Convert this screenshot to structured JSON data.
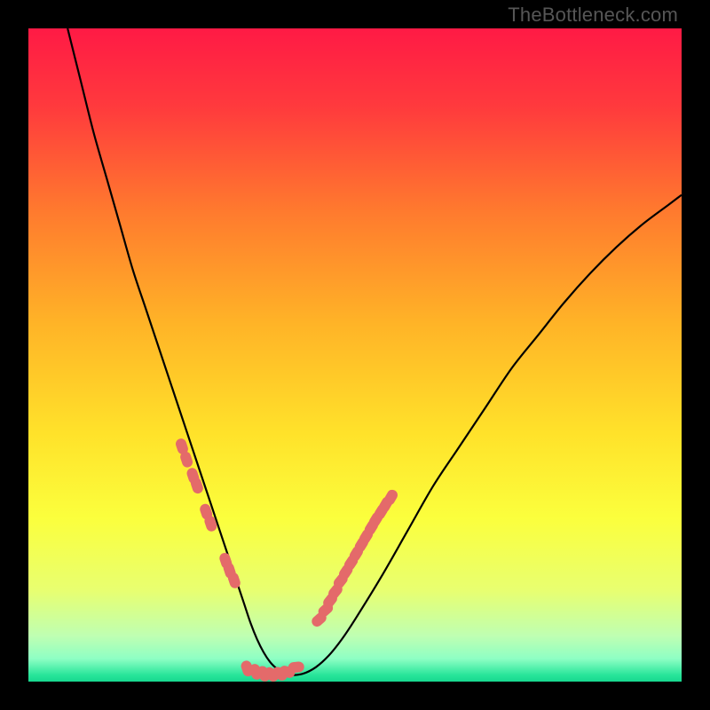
{
  "watermark": "TheBottleneck.com",
  "chart_data": {
    "type": "line",
    "title": "",
    "xlabel": "",
    "ylabel": "",
    "xlim": [
      0,
      100
    ],
    "ylim": [
      0,
      100
    ],
    "gradient_stops": [
      {
        "offset": 0.0,
        "color": "#ff1a45"
      },
      {
        "offset": 0.12,
        "color": "#ff3a3d"
      },
      {
        "offset": 0.28,
        "color": "#ff7a2e"
      },
      {
        "offset": 0.45,
        "color": "#ffb327"
      },
      {
        "offset": 0.62,
        "color": "#ffe22a"
      },
      {
        "offset": 0.75,
        "color": "#fbff3d"
      },
      {
        "offset": 0.86,
        "color": "#e8ff70"
      },
      {
        "offset": 0.93,
        "color": "#bfffb2"
      },
      {
        "offset": 0.965,
        "color": "#8effc4"
      },
      {
        "offset": 0.99,
        "color": "#28e59a"
      },
      {
        "offset": 1.0,
        "color": "#17d88f"
      }
    ],
    "series": [
      {
        "name": "curve",
        "x": [
          6,
          8,
          10,
          12,
          14,
          16,
          18,
          20,
          22,
          24,
          26,
          28,
          30,
          31,
          32,
          33,
          34,
          35,
          36,
          37,
          38,
          39,
          40,
          42,
          44,
          46,
          48,
          50,
          54,
          58,
          62,
          66,
          70,
          74,
          78,
          82,
          86,
          90,
          94,
          98,
          100
        ],
        "y": [
          100,
          92,
          84,
          77,
          70,
          63,
          57,
          51,
          45,
          39,
          33,
          27,
          21,
          18,
          15,
          12,
          9,
          6.5,
          4.5,
          3,
          2,
          1.3,
          1,
          1.2,
          2.2,
          4,
          6.5,
          9.5,
          16,
          23,
          30,
          36,
          42,
          48,
          53,
          58,
          62.5,
          66.5,
          70,
          73,
          74.5
        ],
        "note": "Values are percentages of the plot area (0=bottom/left, 100=top/right) estimated from the figure."
      },
      {
        "name": "left-arm-markers",
        "x": [
          23.5,
          24.2,
          25.2,
          25.8,
          27.2,
          27.9,
          30.2,
          30.8,
          31.5
        ],
        "y": [
          36,
          34,
          31.5,
          30,
          26,
          24.2,
          18.5,
          17,
          15.5
        ]
      },
      {
        "name": "valley-markers",
        "x": [
          33.5,
          34.8,
          36.0,
          37.2,
          38.5,
          39.6,
          41.0
        ],
        "y": [
          2.0,
          1.5,
          1.2,
          1.1,
          1.2,
          1.5,
          2.2
        ]
      },
      {
        "name": "right-arm-markers",
        "x": [
          44.5,
          45.5,
          46.2,
          47.0,
          47.8,
          48.6,
          49.4,
          50.2,
          51.0,
          51.7,
          52.5,
          53.2,
          54.0,
          54.7,
          55.5
        ],
        "y": [
          9.5,
          11.0,
          12.4,
          13.8,
          15.4,
          16.8,
          18.2,
          19.6,
          21.0,
          22.2,
          23.6,
          24.8,
          26.0,
          27.1,
          28.2
        ]
      }
    ],
    "marker_style": {
      "fill": "#e46a6a",
      "rx": 6,
      "ry": 9,
      "note": "Markers are small salmon lozenges oriented along the local curve tangent."
    }
  }
}
